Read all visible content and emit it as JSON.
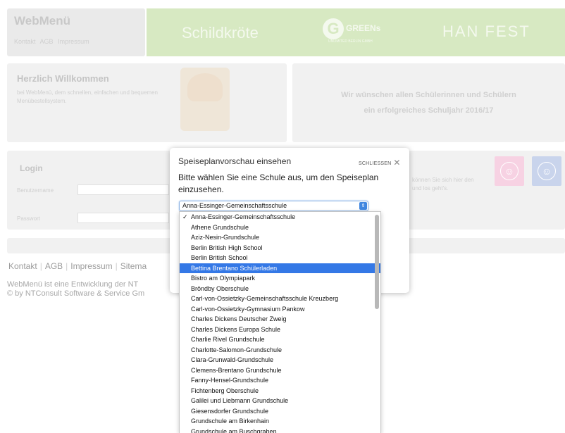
{
  "header": {
    "brand": "WebMenü",
    "links": [
      "Kontakt",
      "AGB",
      "Impressum"
    ]
  },
  "banner": {
    "schildkroete": "Schildkröte",
    "greens": "GREENs",
    "greens_tagline": "UNLIMITED BERLIN GMBH",
    "handfest": "HAN FEST"
  },
  "welcome": {
    "title": "Herzlich Willkommen",
    "text": "bei WebMenü, dem schnellen, einfachen und bequemen Menübestellsystem."
  },
  "greeting": {
    "line1": "Wir wünschen allen Schülerinnen und Schülern",
    "line2": "ein erfolgreiches Schuljahr 2016/17"
  },
  "login": {
    "title": "Login",
    "username_label": "Benutzername",
    "password_label": "Passwort"
  },
  "info": {
    "text": "können Sie sich hier den und los geht's."
  },
  "footer": {
    "links": [
      "Kontakt",
      "AGB",
      "Impressum",
      "Sitema"
    ],
    "note_line1": "WebMenü ist eine Entwicklung der NT",
    "note_line2": "© by NTConsult Software & Service Gm"
  },
  "modal": {
    "title": "Speiseplanvorschau einsehen",
    "close_label": "SCHLIESSEN",
    "prompt": "Bitte wählen Sie eine Schule aus, um den Speiseplan einzusehen.",
    "selected_value": "Anna-Essinger-Gemeinschaftsschule"
  },
  "dropdown": {
    "checked_index": 0,
    "highlighted_index": 5,
    "options": [
      "Anna-Essinger-Gemeinschaftsschule",
      "Athene Grundschule",
      "Aziz-Nesin-Grundschule",
      "Berlin British High School",
      "Berlin British School",
      "Bettina Brentano Schülerladen",
      "Bistro am Olympiapark",
      "Bröndby Oberschule",
      "Carl-von-Ossietzky-Gemeinschaftsschule Kreuzberg",
      "Carl-von-Ossietzky-Gymnasium Pankow",
      "Charles Dickens Deutscher Zweig",
      "Charles Dickens Europa Schule",
      "Charlie Rivel Grundschule",
      "Charlotte-Salomon-Grundschule",
      "Clara-Grunwald-Grundschule",
      "Clemens-Brentano Grundschule",
      "Fanny-Hensel-Grundschule",
      "Fichtenberg Oberschule",
      "Galilei und Liebmann Grundschule",
      "Giesensdorfer Grundschule",
      "Grundschule am Birkenhain",
      "Grundschule am Buschgraben"
    ]
  },
  "colors": {
    "highlight": "#3478e6",
    "banner": "#d7e9c2"
  }
}
